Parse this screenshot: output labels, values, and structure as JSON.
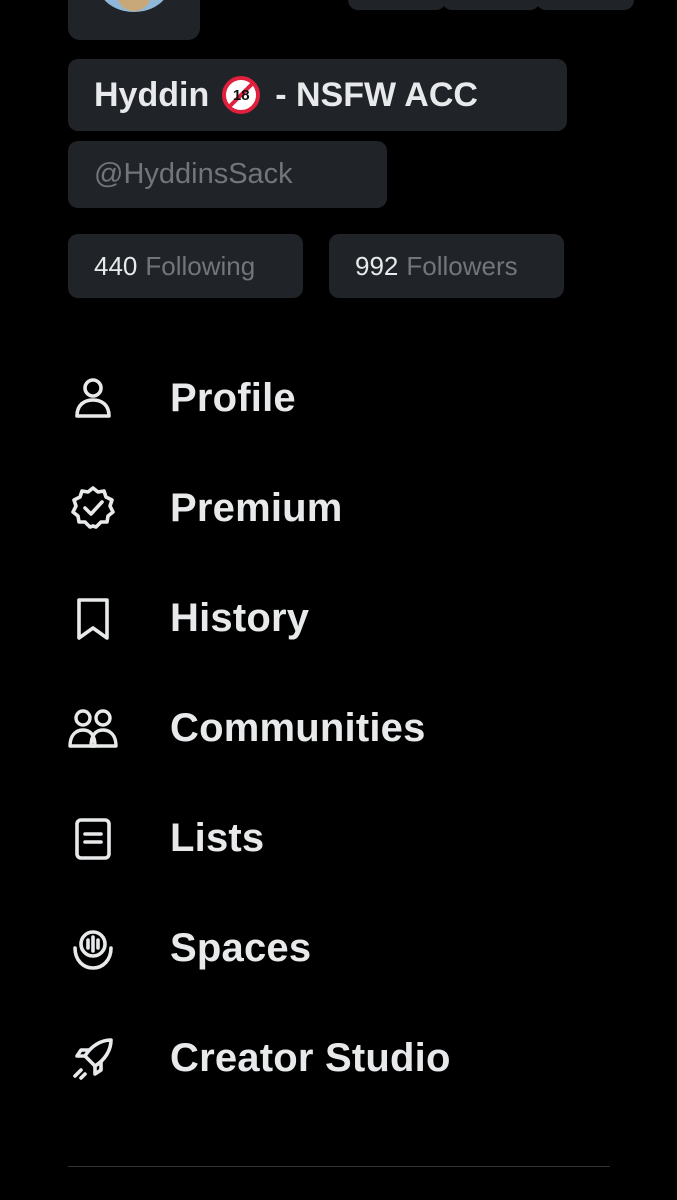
{
  "profile": {
    "display_name": "Hyddin",
    "badge_text": "18",
    "name_suffix": "- NSFW ACC",
    "handle": "@HyddinsSack"
  },
  "stats": {
    "following_count": "440",
    "following_label": "Following",
    "followers_count": "992",
    "followers_label": "Followers"
  },
  "menu": {
    "items": [
      {
        "label": "Profile",
        "icon": "person-icon"
      },
      {
        "label": "Premium",
        "icon": "verified-badge-icon"
      },
      {
        "label": "History",
        "icon": "bookmark-icon"
      },
      {
        "label": "Communities",
        "icon": "people-icon"
      },
      {
        "label": "Lists",
        "icon": "list-document-icon"
      },
      {
        "label": "Spaces",
        "icon": "microphone-icon"
      },
      {
        "label": "Creator Studio",
        "icon": "rocket-icon"
      }
    ]
  },
  "colors": {
    "background": "#000000",
    "pill": "#202327",
    "text_primary": "#e7e9ea",
    "text_secondary": "#71767b",
    "badge_red": "#e0203c"
  }
}
